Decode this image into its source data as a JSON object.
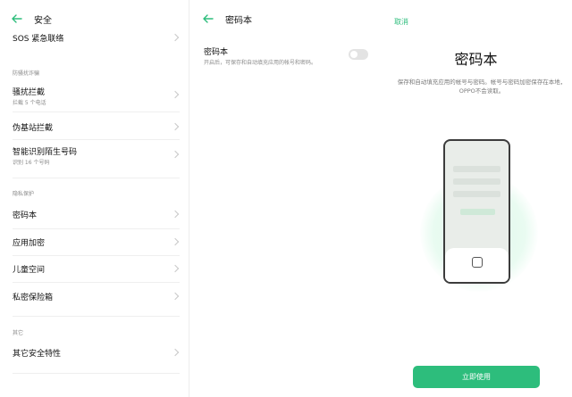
{
  "left": {
    "title": "安全",
    "sos_label": "SOS 紧急联络",
    "section_fraud": "防骚扰诈骗",
    "harass": {
      "label": "骚扰拦截",
      "sub": "拦截 5 个电话"
    },
    "fake_station": {
      "label": "伪基站拦截"
    },
    "smart_id": {
      "label": "智能识别陌生号码",
      "sub": "识别 16 个号码"
    },
    "section_privacy": "隐私保护",
    "password_book": {
      "label": "密码本"
    },
    "app_lock": {
      "label": "应用加密"
    },
    "kids_space": {
      "label": "儿童空间"
    },
    "private_safe": {
      "label": "私密保险箱"
    },
    "section_other": "其它",
    "other_security": {
      "label": "其它安全特性"
    }
  },
  "middle": {
    "title": "密码本",
    "setting_label": "密码本",
    "setting_desc": "开启后，可保存和自动填充应用的帐号和密码。"
  },
  "right": {
    "cancel": "取消",
    "title": "密码本",
    "desc": "保存和自动填充应用的帐号与密码。帐号与密码加密保存在本地，OPPO不会读取。",
    "cta": "立即使用"
  },
  "colors": {
    "accent": "#2dbd7c",
    "toggle_off": "#e3e3e3"
  },
  "icons": {
    "back": "arrow-left-icon",
    "chevron": "chevron-right-icon",
    "sheet": "lock-icon"
  }
}
